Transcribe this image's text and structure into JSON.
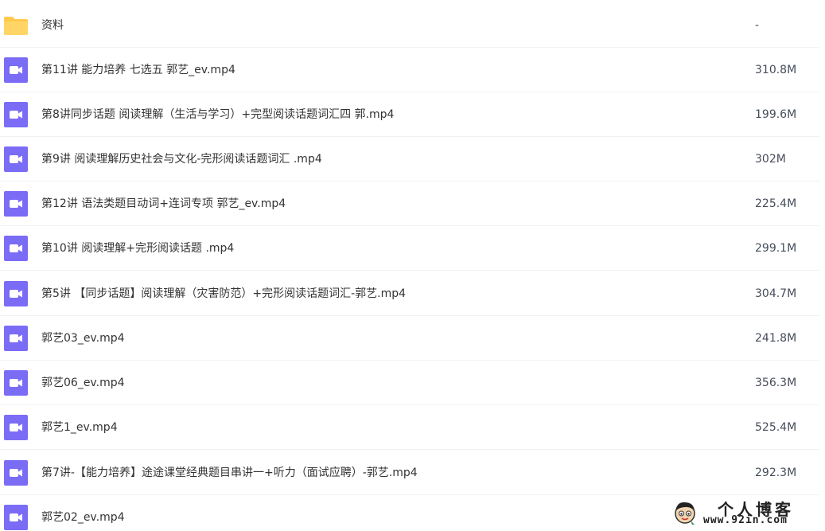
{
  "files": [
    {
      "type": "folder",
      "icon": "folder-icon",
      "name": "资料",
      "size": "-"
    },
    {
      "type": "video",
      "icon": "video-file-icon",
      "name": "第11讲 能力培养 七选五 郭艺_ev.mp4",
      "size": "310.8M"
    },
    {
      "type": "video",
      "icon": "video-file-icon",
      "name": "第8讲同步话题 阅读理解（生活与学习）+完型阅读话题词汇四 郭.mp4",
      "size": "199.6M"
    },
    {
      "type": "video",
      "icon": "video-file-icon",
      "name": "第9讲 阅读理解历史社会与文化-完形阅读话题词汇 .mp4",
      "size": "302M"
    },
    {
      "type": "video",
      "icon": "video-file-icon",
      "name": "第12讲 语法类题目动词+连词专项 郭艺_ev.mp4",
      "size": "225.4M"
    },
    {
      "type": "video",
      "icon": "video-file-icon",
      "name": "第10讲 阅读理解+完形阅读话题 .mp4",
      "size": "299.1M"
    },
    {
      "type": "video",
      "icon": "video-file-icon",
      "name": "第5讲 【同步话题】阅读理解（灾害防范）+完形阅读话题词汇-郭艺.mp4",
      "size": "304.7M"
    },
    {
      "type": "video",
      "icon": "video-file-icon",
      "name": "郭艺03_ev.mp4",
      "size": "241.8M"
    },
    {
      "type": "video",
      "icon": "video-file-icon",
      "name": "郭艺06_ev.mp4",
      "size": "356.3M"
    },
    {
      "type": "video",
      "icon": "video-file-icon",
      "name": "郭艺1_ev.mp4",
      "size": "525.4M"
    },
    {
      "type": "video",
      "icon": "video-file-icon",
      "name": "第7讲-【能力培养】途途课堂经典题目串讲一+听力（面试应聘）-郭艺.mp4",
      "size": "292.3M"
    },
    {
      "type": "video",
      "icon": "video-file-icon",
      "name": "郭艺02_ev.mp4",
      "size": ""
    }
  ],
  "watermark": {
    "title": "个人博客",
    "url": "www.92in.com"
  },
  "colors": {
    "folder": "#ffc94d",
    "video": "#7b6cf6",
    "text": "#333333",
    "size_text": "#454d5a"
  }
}
